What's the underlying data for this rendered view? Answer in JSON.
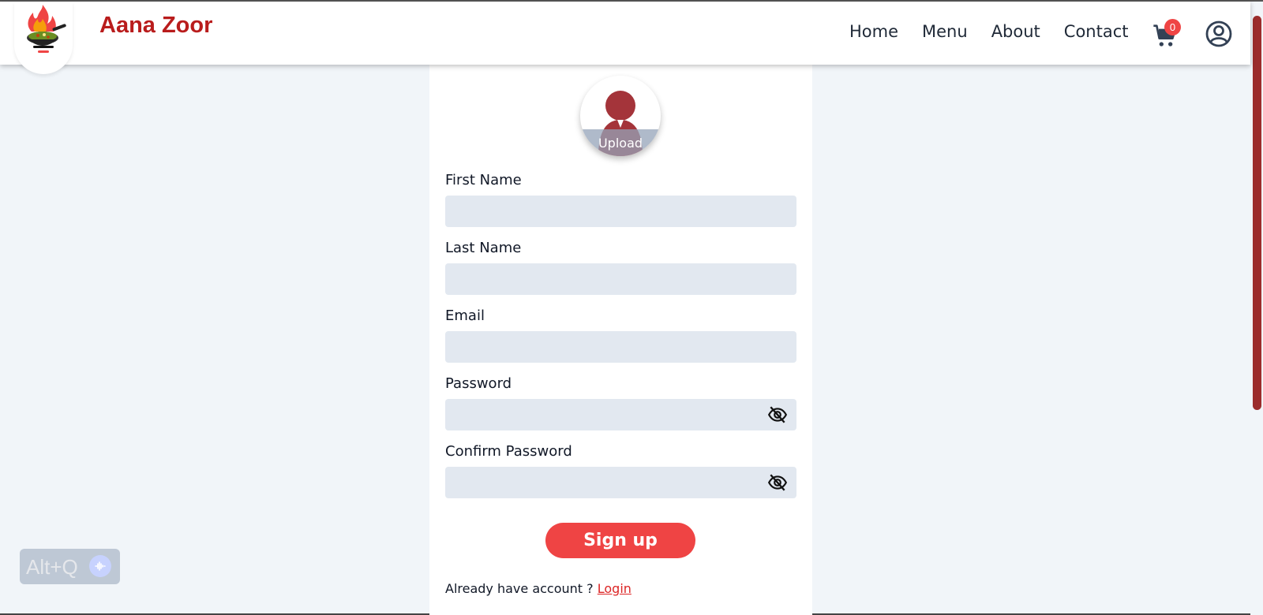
{
  "brand": {
    "name": "Aana Zoor",
    "logo_text": "Aana Zoor"
  },
  "nav": {
    "items": [
      "Home",
      "Menu",
      "About",
      "Contact"
    ]
  },
  "cart": {
    "count": "0",
    "icon": "cart-icon"
  },
  "user": {
    "icon": "user-circle-icon"
  },
  "form": {
    "avatar_label": "Upload",
    "first_name_label": "First Name",
    "first_name_value": "",
    "last_name_label": "Last Name",
    "last_name_value": "",
    "email_label": "Email",
    "email_value": "",
    "password_label": "Password",
    "password_value": "",
    "confirm_password_label": "Confirm Password",
    "confirm_password_value": "",
    "signup_label": "Sign up",
    "already_text": "Already have account ? ",
    "login_label": "Login"
  },
  "widget": {
    "shortcut": "Alt+Q"
  },
  "colors": {
    "brand": "#b91c1c",
    "accent": "#ef4444",
    "background": "#f1f5f9",
    "input": "#e2e8f0",
    "scrollbar": "#9b2c2c"
  }
}
